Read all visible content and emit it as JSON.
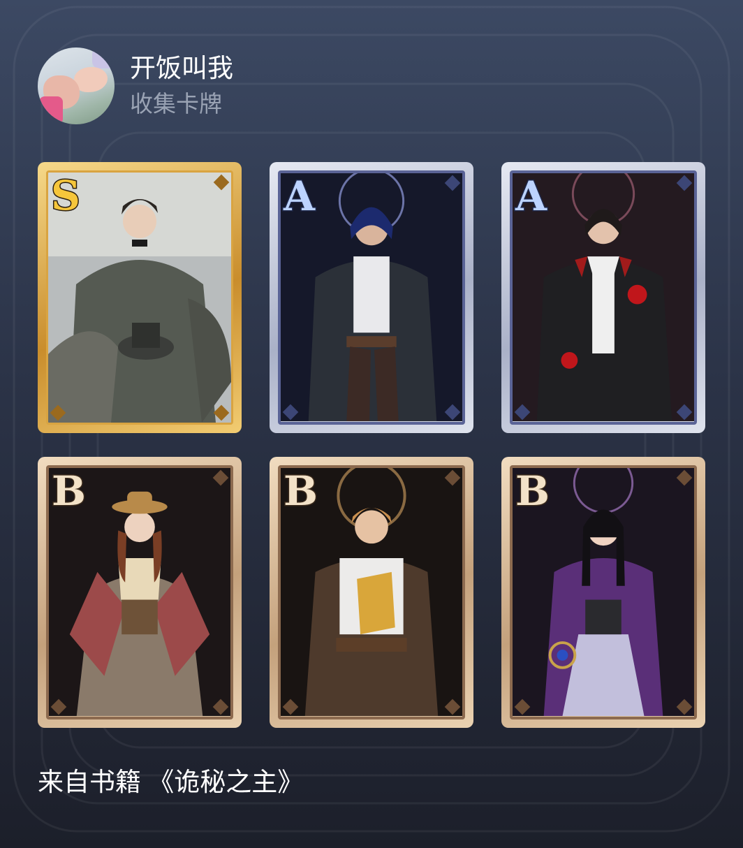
{
  "header": {
    "user_name": "开饭叫我",
    "subtitle": "收集卡牌"
  },
  "cards": [
    {
      "rank": "S",
      "icon": "character-portrait-gentleman-top-hat"
    },
    {
      "rank": "A",
      "icon": "character-portrait-blue-hair-coat"
    },
    {
      "rank": "A",
      "icon": "character-portrait-red-gloves-coat"
    },
    {
      "rank": "B",
      "icon": "character-portrait-woman-hat-shawl"
    },
    {
      "rank": "B",
      "icon": "character-portrait-blond-leather-armor"
    },
    {
      "rank": "B",
      "icon": "character-portrait-woman-purple-coat"
    }
  ],
  "footer": {
    "source": "来自书籍 《诡秘之主》"
  },
  "colors": {
    "rank_S": "#f6c63b",
    "rank_A": "#bcd3ff",
    "rank_B": "#f3e2c8",
    "background": "#2b3347"
  }
}
